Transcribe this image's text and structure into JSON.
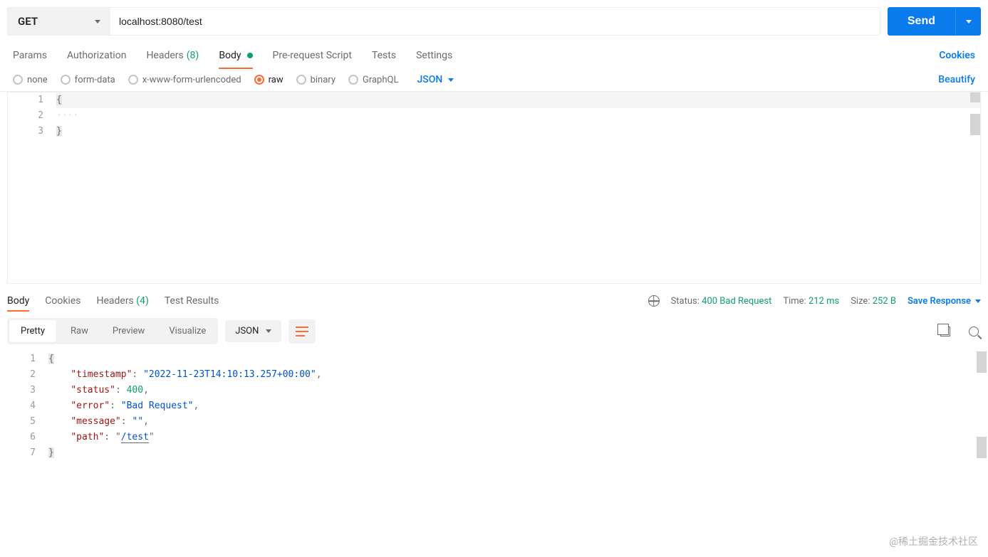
{
  "request": {
    "method": "GET",
    "url": "localhost:8080/test",
    "send_label": "Send"
  },
  "tabs": {
    "params": "Params",
    "authorization": "Authorization",
    "headers": "Headers",
    "headers_count": "(8)",
    "body": "Body",
    "prerequest": "Pre-request Script",
    "tests": "Tests",
    "settings": "Settings",
    "cookies_link": "Cookies"
  },
  "body_types": {
    "none": "none",
    "form_data": "form-data",
    "urlencoded": "x-www-form-urlencoded",
    "raw": "raw",
    "binary": "binary",
    "graphql": "GraphQL",
    "format": "JSON",
    "beautify": "Beautify"
  },
  "request_body_lines": [
    "{",
    "····",
    "}"
  ],
  "response": {
    "tabs": {
      "body": "Body",
      "cookies": "Cookies",
      "headers": "Headers",
      "headers_count": "(4)",
      "test_results": "Test Results"
    },
    "status_label": "Status:",
    "status_value": "400 Bad Request",
    "time_label": "Time:",
    "time_value": "212 ms",
    "size_label": "Size:",
    "size_value": "252 B",
    "save_label": "Save Response"
  },
  "view_modes": {
    "pretty": "Pretty",
    "raw": "Raw",
    "preview": "Preview",
    "visualize": "Visualize",
    "format": "JSON"
  },
  "response_json": {
    "timestamp": "2022-11-23T14:10:13.257+00:00",
    "status": 400,
    "error": "Bad Request",
    "message": "",
    "path": "/test"
  },
  "watermark": "@稀土掘金技术社区"
}
